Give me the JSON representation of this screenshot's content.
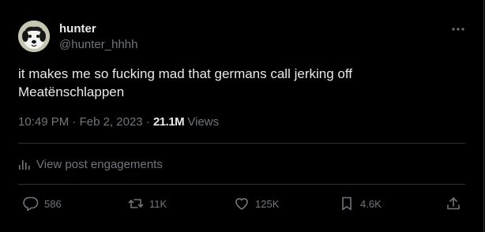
{
  "author": {
    "name": "hunter",
    "handle": "@hunter_hhhh",
    "avatar_icon": "dog-avatar"
  },
  "post": {
    "line1": "it makes me so fucking mad that germans call jerking off",
    "line2": "Meatënschlappen"
  },
  "meta": {
    "time": "10:49 PM",
    "separator": " · ",
    "date": "Feb 2, 2023",
    "views_count": "21.1M",
    "views_label": " Views"
  },
  "engagements_label": "View post engagements",
  "actions": {
    "replies": "586",
    "reposts": "11K",
    "likes": "125K",
    "bookmarks": "4.6K"
  },
  "colors": {
    "background": "#000000",
    "text": "#e7e9ea",
    "muted": "#71767b",
    "divider": "#2f3336"
  }
}
